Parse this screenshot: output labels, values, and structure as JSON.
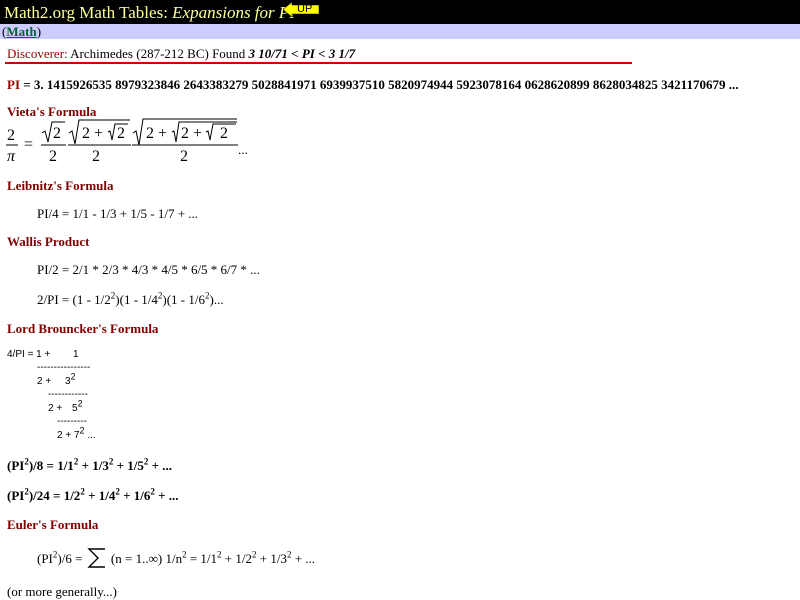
{
  "header": {
    "site": "Math2.org Math Tables:",
    "subtitle": "Expansions for PI",
    "up_label": "UP",
    "bg_color": "#000000",
    "title_color": "#ffff99"
  },
  "nav": {
    "open": "(",
    "link": "Math",
    "close": ")"
  },
  "discoverer": {
    "label": "Discoverer:",
    "text": " Archimedes (287-212 BC) Found ",
    "bounds": "3 10/71 < PI < 3 1/7"
  },
  "pi": {
    "label": "PI",
    "value": " = 3. 1415926535 8979323846 2643383279 5028841971 6939937510 5820974944 5923078164 0628620899 8628034825 3421170679 ..."
  },
  "vieta": {
    "heading": "Vieta's Formula",
    "ellipsis": "..."
  },
  "leibniz": {
    "heading": "Leibnitz's Formula",
    "formula": "PI/4 = 1/1 - 1/3 + 1/5 - 1/7 + ..."
  },
  "wallis": {
    "heading": "Wallis Product",
    "formula1": "PI/2 = 2/1 * 2/3 * 4/3 * 4/5 * 6/5 * 6/7 * ...",
    "f2_a": "2/PI = (1 - 1/2",
    "f2_b": ")(1 - 1/4",
    "f2_c": ")(1 - 1/6",
    "f2_d": ")...",
    "sup": "2"
  },
  "brouncker": {
    "heading": "Lord Brouncker's Formula",
    "l1a": "4/PI = 1 +",
    "l1b": "1",
    "d1": "----------------",
    "l2a": "2 +",
    "l2b": "3",
    "d2": "------------",
    "l3a": "2 +",
    "l3b": "5",
    "d3": "---------",
    "l4a": "2 + 7",
    "l4b": " ...",
    "sup": "2"
  },
  "series1": {
    "a": "(PI",
    "b": ")/8 = 1/1",
    "c": " + 1/3",
    "d": " + 1/5",
    "e": " + ...",
    "sup": "2"
  },
  "series2": {
    "a": "(PI",
    "b": ")/24 = 1/2",
    "c": " + 1/4",
    "d": " + 1/6",
    "e": " + ...",
    "sup": "2"
  },
  "euler": {
    "heading": "Euler's Formula",
    "a": "(PI",
    "b": ")/6 =",
    "c": " (n = 1..",
    "inf": "∞",
    "d": ") 1/n",
    "e": " = 1/1",
    "f": " + 1/2",
    "g": " + 1/3",
    "h": " + ...",
    "sup": "2"
  },
  "more": "(or more generally...)"
}
